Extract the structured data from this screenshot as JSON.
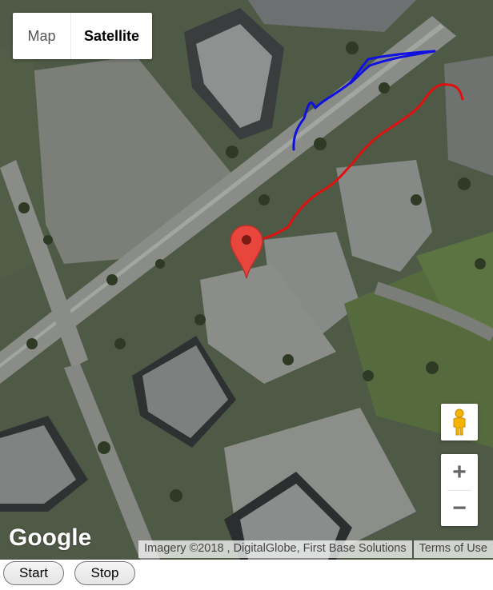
{
  "map": {
    "type_control": {
      "map_label": "Map",
      "satellite_label": "Satellite",
      "selected": "Satellite"
    },
    "zoom": {
      "in_label": "+",
      "out_label": "−"
    },
    "logo_text": "Google",
    "attribution": "Imagery ©2018 , DigitalGlobe, First Base Solutions",
    "terms_label": "Terms of Use",
    "marker_color": "#e8453c",
    "tracks": [
      {
        "color": "#e01010",
        "icon": "red-route"
      },
      {
        "color": "#1010e0",
        "icon": "blue-route"
      }
    ],
    "pegman_icon": "pegman-icon"
  },
  "controls": {
    "start_label": "Start",
    "stop_label": "Stop"
  }
}
